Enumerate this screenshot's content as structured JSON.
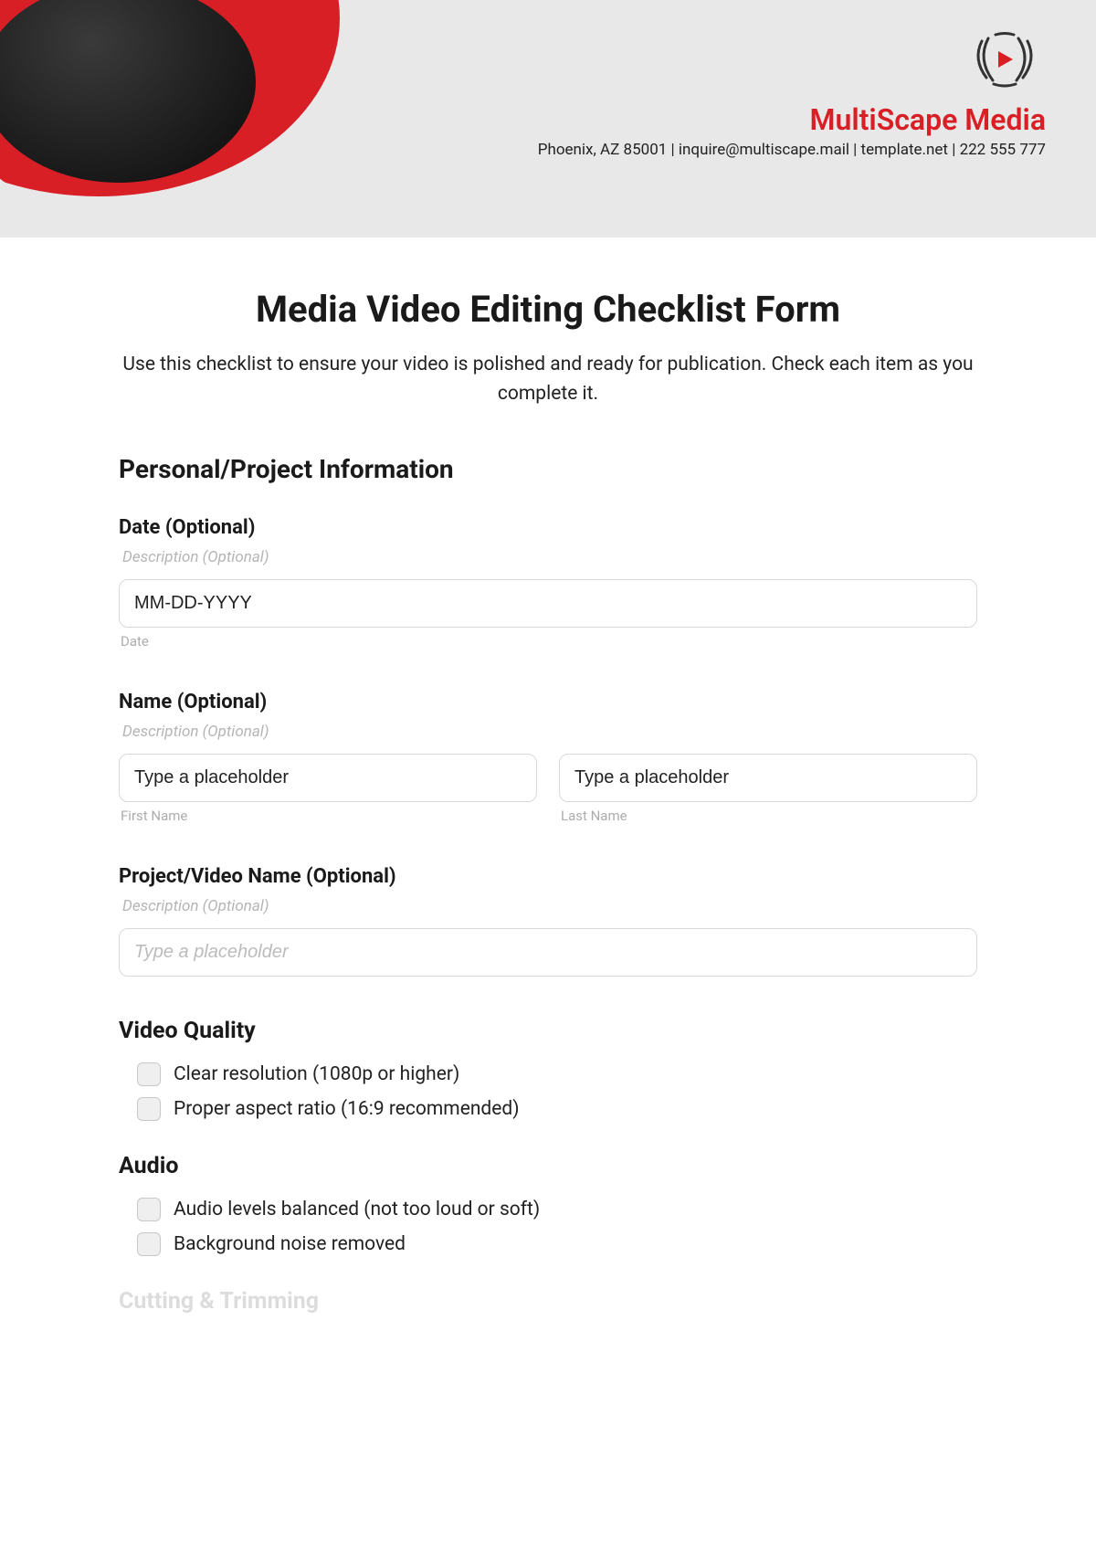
{
  "brand": {
    "name": "MultiScape Media",
    "sub": "Phoenix, AZ 85001 | inquire@multiscape.mail | template.net | 222 555 777"
  },
  "form": {
    "title": "Media Video Editing Checklist Form",
    "desc": "Use this checklist to ensure your video is polished and ready for publication. Check each item as you complete it."
  },
  "sections": {
    "personal": "Personal/Project Information",
    "video_quality": "Video Quality",
    "audio": "Audio",
    "cutting": "Cutting & Trimming"
  },
  "fields": {
    "date": {
      "label": "Date (Optional)",
      "desc": "Description (Optional)",
      "value": "MM-DD-YYYY",
      "sublabel": "Date"
    },
    "name": {
      "label": "Name (Optional)",
      "desc": "Description (Optional)",
      "first_placeholder": "Type a placeholder",
      "last_placeholder": "Type a placeholder",
      "first_sub": "First Name",
      "last_sub": "Last Name"
    },
    "project": {
      "label": "Project/Video Name (Optional)",
      "desc": "Description (Optional)",
      "placeholder": "Type a placeholder"
    }
  },
  "checklist": {
    "video_quality": [
      "Clear resolution (1080p or higher)",
      "Proper aspect ratio (16:9 recommended)"
    ],
    "audio": [
      "Audio levels balanced (not too loud or soft)",
      "Background noise removed"
    ]
  }
}
